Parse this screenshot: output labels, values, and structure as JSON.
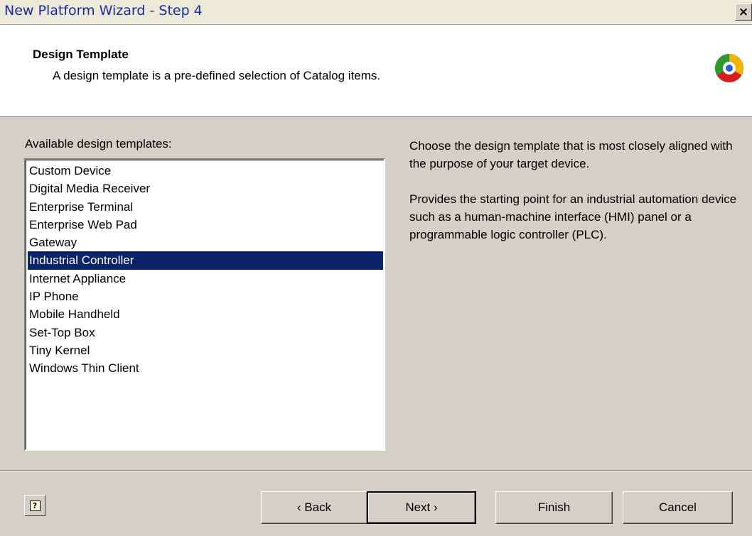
{
  "window": {
    "title": "New Platform Wizard - Step 4",
    "close_glyph": "×"
  },
  "header": {
    "title": "Design Template",
    "subtitle": "A design template is a pre-defined selection of Catalog items.",
    "icon": "wizard-logo-icon"
  },
  "list": {
    "label": "Available design templates:",
    "items": [
      "Custom Device",
      "Digital Media Receiver",
      "Enterprise Terminal",
      "Enterprise Web Pad",
      "Gateway",
      "Industrial Controller",
      "Internet Appliance",
      "IP Phone",
      "Mobile Handheld",
      "Set-Top Box",
      "Tiny Kernel",
      "Windows Thin Client"
    ],
    "selected": "Industrial Controller"
  },
  "description": {
    "instruction": "Choose the design template that is most closely aligned with the purpose of your target device.",
    "detail": "Provides the starting point for an industrial automation device such as a human-machine interface (HMI) panel or a programmable logic controller (PLC)."
  },
  "buttons": {
    "help_glyph": "?",
    "back": "‹ Back",
    "next": "Next ›",
    "finish": "Finish",
    "cancel": "Cancel"
  },
  "colors": {
    "selection": "#0a246a",
    "title_text": "#1a2b9c",
    "face": "#d4d0c8"
  }
}
